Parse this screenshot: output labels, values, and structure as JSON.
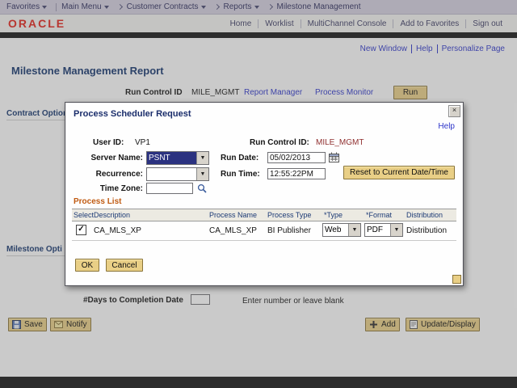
{
  "colors": {
    "oracle_red": "#e2231a",
    "link_blue": "#2d35c9",
    "button_tan": "#e9cf86",
    "title_navy": "#15356e",
    "process_list_orange": "#c05a11",
    "selected_navy": "#2b3280"
  },
  "icons": {
    "close": "×",
    "check": "✓",
    "dropdown_arrow": "▼"
  },
  "header": {
    "topnav": {
      "favorites": "Favorites",
      "main_menu": "Main Menu",
      "crumbs": [
        "Customer Contracts",
        "Reports",
        "Milestone Management"
      ]
    },
    "logo": "ORACLE",
    "links": [
      "Home",
      "Worklist",
      "MultiChannel Console",
      "Add to Favorites",
      "Sign out"
    ]
  },
  "pagebar": {
    "links": [
      "New Window",
      "Help",
      "Personalize Page"
    ]
  },
  "page": {
    "title": "Milestone Management Report",
    "run_control_label": "Run Control ID",
    "run_control_value": "MILE_MGMT",
    "report_manager_link": "Report Manager",
    "process_monitor_link": "Process Monitor",
    "run_button": "Run",
    "contract_options_header": "Contract Option",
    "milestone_options_header": "Milestone Opti",
    "days_to_completion_label": "#Days to Completion Date",
    "days_hint": "Enter number or leave blank",
    "save_button": "Save",
    "notify_button": "Notify",
    "add_button": "Add",
    "update_display_button": "Update/Display"
  },
  "modal": {
    "title": "Process Scheduler Request",
    "help_link": "Help",
    "user_id_label": "User ID:",
    "user_id_value": "VP1",
    "run_control_label": "Run Control ID:",
    "run_control_value": "MILE_MGMT",
    "server_name_label": "Server Name:",
    "server_name_value": "PSNT",
    "run_date_label": "Run Date:",
    "run_date_value": "05/02/2013",
    "recurrence_label": "Recurrence:",
    "recurrence_value": "",
    "run_time_label": "Run Time:",
    "run_time_value": "12:55:22PM",
    "reset_button": "Reset to Current Date/Time",
    "time_zone_label": "Time Zone:",
    "time_zone_value": "",
    "process_list": {
      "title": "Process List",
      "columns": [
        "Select",
        "Description",
        "Process Name",
        "Process Type",
        "*Type",
        "*Format",
        "Distribution"
      ],
      "row": {
        "selected": true,
        "description": "CA_MLS_XP",
        "process_name": "CA_MLS_XP",
        "process_type": "BI Publisher",
        "type_value": "Web",
        "format_value": "PDF",
        "distribution_link": "Distribution"
      }
    },
    "ok_button": "OK",
    "cancel_button": "Cancel"
  }
}
